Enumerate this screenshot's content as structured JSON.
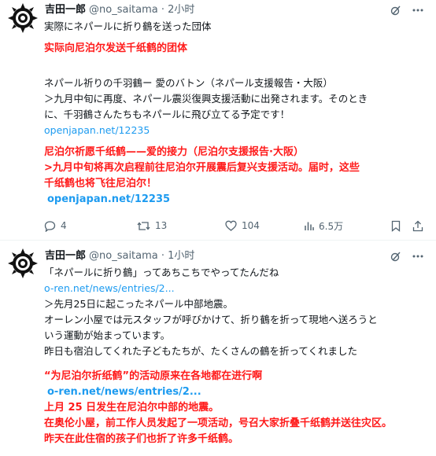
{
  "tweets": [
    {
      "author": {
        "name": "吉田一郎",
        "handle": "@no_saitama · 2小时"
      },
      "text": "実際にネパールに折り鶴を送った団体",
      "translation": "实际向尼泊尔发送千纸鹤的团体",
      "quote": {
        "title": "ネパール祈りの千羽鶴ー 愛のバトン（ネパール支援報告・大阪）",
        "line1": "＞九月中旬に再度、ネパール震災復興支援活動に出発されます。そのとき",
        "line2": "に、千羽鶴さんたちもネパールに飛び立てる予定です！",
        "link": "openjapan.net/12235"
      },
      "quote_translation": {
        "title": "尼泊尔祈愿千纸鹤——爱的接力（尼泊尔支援报告·大阪）",
        "line1": ">九月中旬将再次启程前往尼泊尔开展震后复兴支援活动。届时，这些",
        "line2": "千纸鹤也将飞往尼泊尔！",
        "link": "openjapan.net/12235"
      },
      "stats": {
        "replies": "4",
        "retweets": "13",
        "likes": "104",
        "views": "6.5万"
      }
    },
    {
      "author": {
        "name": "吉田一郎",
        "handle": "@no_saitama · 1小时"
      },
      "lines": [
        "「ネパールに折り鶴」ってあちこちでやってたんだね",
        "o-ren.net/news/entries/2...",
        "＞先月25日に起こったネパール中部地震。",
        "オーレン小屋では元スタッフが呼びかけて、折り鶴を折って現地へ送ろうと",
        "いう運動が始まっています。",
        "昨日も宿泊してくれた子どもたちが、たくさんの鶴を折ってくれました"
      ],
      "translation": {
        "line1": "“为尼泊尔折纸鹤”的活动原来在各地都在进行啊",
        "link": "o-ren.net/news/entries/2...",
        "line2": "上月 25 日发生在尼泊尔中部的地震。",
        "line3": "在奥伦小屋，前工作人员发起了一项活动，号召大家折叠千纸鹤并送往灾区。",
        "line4": "昨天在此住宿的孩子们也折了许多千纸鹤。"
      }
    }
  ],
  "colors": {
    "text": "#0f1419",
    "secondary": "#536471",
    "link": "#1d9bf0",
    "translation": "#ff1a1a",
    "divider": "#eff3f4"
  },
  "icons": [
    "grok-icon",
    "more-icon",
    "reply-icon",
    "retweet-icon",
    "like-icon",
    "views-icon",
    "bookmark-icon",
    "share-icon"
  ]
}
